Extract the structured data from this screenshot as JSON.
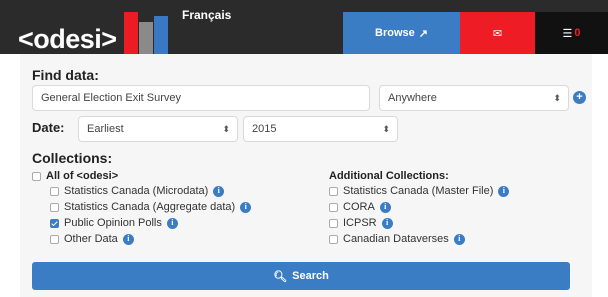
{
  "header": {
    "logo": "<odesi>",
    "language_link": "Français",
    "browse_label": "Browse",
    "browse_icon": "external-link-icon",
    "mail_icon": "envelope-icon",
    "list_icon": "list-icon",
    "list_count": "0",
    "colors": {
      "browse": "#3b7dc4",
      "mail": "#ee1c25",
      "list": "#111111",
      "bar": "#2b2b2b"
    }
  },
  "find": {
    "heading": "Find data:",
    "query_value": "General Election Exit Survey",
    "scope_selected": "Anywhere"
  },
  "date": {
    "label": "Date:",
    "from_selected": "Earliest",
    "to_selected": "2015"
  },
  "collections": {
    "heading": "Collections:",
    "left": [
      {
        "label": "All of <odesi>",
        "bold": true,
        "checked": false,
        "info": false
      },
      {
        "label": "Statistics Canada (Microdata)",
        "checked": false,
        "info": true
      },
      {
        "label": "Statistics Canada (Aggregate data)",
        "checked": false,
        "info": true
      },
      {
        "label": "Public Opinion Polls",
        "checked": true,
        "info": true
      },
      {
        "label": "Other Data",
        "checked": false,
        "info": true
      }
    ],
    "right_heading": "Additional Collections:",
    "right": [
      {
        "label": "Statistics Canada (Master File)",
        "checked": false,
        "info": true
      },
      {
        "label": "CORA",
        "checked": false,
        "info": true
      },
      {
        "label": "ICPSR",
        "checked": false,
        "info": true
      },
      {
        "label": "Canadian Dataverses",
        "checked": false,
        "info": true
      }
    ]
  },
  "search_button": {
    "label": "Search",
    "icon": "magnifier-icon"
  }
}
